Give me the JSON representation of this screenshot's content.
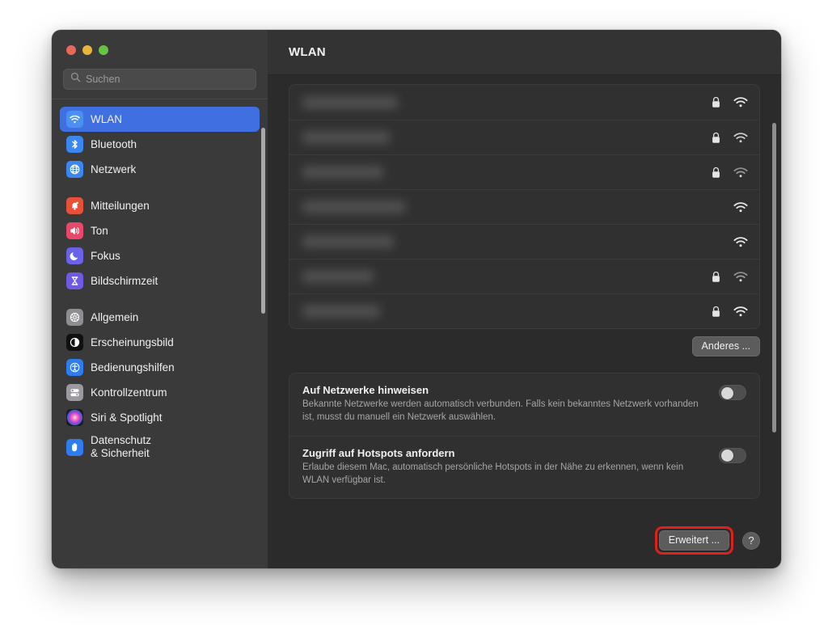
{
  "window": {
    "traffic_lights": [
      {
        "name": "close",
        "color": "#e8685c"
      },
      {
        "name": "minimize",
        "color": "#e9b43a"
      },
      {
        "name": "maximize",
        "color": "#69c343"
      }
    ]
  },
  "search": {
    "placeholder": "Suchen",
    "value": "",
    "icon": "search-icon"
  },
  "sidebar": {
    "groups": [
      {
        "items": [
          {
            "label": "WLAN",
            "icon": "wifi-icon",
            "selected": true
          },
          {
            "label": "Bluetooth",
            "icon": "bluetooth-icon",
            "selected": false
          },
          {
            "label": "Netzwerk",
            "icon": "globe-icon",
            "selected": false
          }
        ]
      },
      {
        "items": [
          {
            "label": "Mitteilungen",
            "icon": "bell-icon",
            "selected": false
          },
          {
            "label": "Ton",
            "icon": "speaker-icon",
            "selected": false
          },
          {
            "label": "Fokus",
            "icon": "moon-icon",
            "selected": false
          },
          {
            "label": "Bildschirmzeit",
            "icon": "hourglass-icon",
            "selected": false
          }
        ]
      },
      {
        "items": [
          {
            "label": "Allgemein",
            "icon": "gear-icon",
            "selected": false
          },
          {
            "label": "Erscheinungsbild",
            "icon": "appearance-icon",
            "selected": false
          },
          {
            "label": "Bedienungshilfen",
            "icon": "accessibility-icon",
            "selected": false
          },
          {
            "label": "Kontrollzentrum",
            "icon": "sliders-icon",
            "selected": false
          },
          {
            "label": "Siri & Spotlight",
            "icon": "siri-icon",
            "selected": false
          },
          {
            "label": "Datenschutz\n& Sicherheit",
            "icon": "hand-icon",
            "selected": false
          }
        ]
      }
    ]
  },
  "header": {
    "title": "WLAN"
  },
  "networks": {
    "rows": [
      {
        "name_redacted": true,
        "blur_width": 118,
        "secured": true,
        "signal": "strong"
      },
      {
        "name_redacted": true,
        "blur_width": 108,
        "secured": true,
        "signal": "strong"
      },
      {
        "name_redacted": true,
        "blur_width": 100,
        "secured": true,
        "signal": "weak"
      },
      {
        "name_redacted": true,
        "blur_width": 128,
        "secured": false,
        "signal": "strong"
      },
      {
        "name_redacted": true,
        "blur_width": 113,
        "secured": false,
        "signal": "strong"
      },
      {
        "name_redacted": true,
        "blur_width": 88,
        "secured": true,
        "signal": "weak"
      },
      {
        "name_redacted": true,
        "blur_width": 96,
        "secured": true,
        "signal": "strong"
      }
    ],
    "other_button": "Anderes ..."
  },
  "options": [
    {
      "title": "Auf Netzwerke hinweisen",
      "description": "Bekannte Netzwerke werden automatisch verbunden. Falls kein bekanntes Netzwerk vorhanden ist, musst du manuell ein Netzwerk auswählen.",
      "toggle_on": false
    },
    {
      "title": "Zugriff auf Hotspots anfordern",
      "description": "Erlaube diesem Mac, automatisch persönliche Hotspots in der Nähe zu erkennen, wenn kein WLAN verfügbar ist.",
      "toggle_on": false
    }
  ],
  "footer": {
    "advanced_button": "Erweitert ...",
    "help_button": "?",
    "highlight_color": "#e01f1f"
  }
}
